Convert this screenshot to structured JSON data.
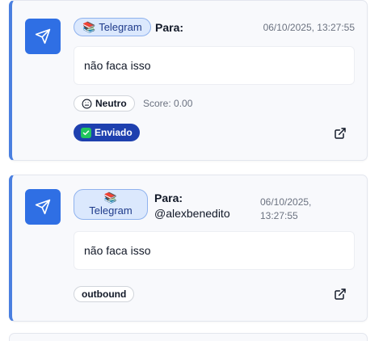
{
  "messages": [
    {
      "channel": "Telegram",
      "channel_icon": "books-emoji",
      "to_label": "Para:",
      "to_user": "",
      "timestamp": "06/10/2025, 13:27:55",
      "text": "não faca isso",
      "sentiment": "Neutro",
      "score": "Score: 0.00",
      "status": "Enviado"
    },
    {
      "channel": "Telegram",
      "channel_icon": "books-emoji",
      "to_label": "Para:",
      "to_user": "@alexbenedito",
      "timestamp_line1": "06/10/2025,",
      "timestamp_line2": "13:27:55",
      "text": "não faca isso",
      "direction": "outbound"
    }
  ],
  "colors": {
    "accent": "#2f6fe4",
    "card_border_left": "#4a7fe0",
    "sent_badge": "#1e40af"
  }
}
